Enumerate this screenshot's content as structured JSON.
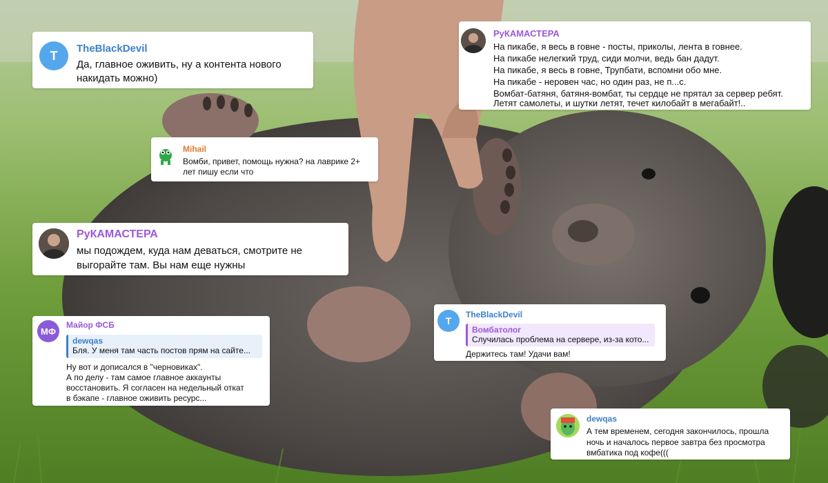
{
  "colors": {
    "blue_name": "#3d7fc9",
    "purple_name": "#9b59d6",
    "orange_name": "#e07a2e",
    "avatar_blue": "#55a7ec",
    "avatar_purple": "#8b5ad8"
  },
  "comments": [
    {
      "author": "TheBlackDevil",
      "avatar_letter": "T",
      "lines": [
        "Да, главное оживить, ну а контента нового",
        "накидать можно)"
      ]
    },
    {
      "author": "РуКАМАСТЕРА",
      "lines": [
        "На пикабе, я весь в говне - посты, приколы, лента в говнее.",
        "На пикабе нелегкий труд, сиди молчи, ведь бан дадут.",
        "На пикабе, я весь в говне, Трупбати, вспомни обо мне.",
        "На пикабе - неровен час, но один раз, не п...с.",
        "Вомбат-батяня, батяня-вомбат, ты сердце не прятал за сервер ребят.",
        "Летят самолеты, и шутки летят, течет килобайт в мегабайт!.."
      ]
    },
    {
      "author": "Mihail",
      "lines": [
        "Вомби, привет, помощь нужна? на лаврике 2+",
        "лет пишу если что"
      ]
    },
    {
      "author": "РуКАМАСТЕРА",
      "lines": [
        "мы подождем, куда нам деваться, смотрите не",
        "выгорайте там. Вы нам еще нужны"
      ]
    },
    {
      "author": "Майор ФСБ",
      "avatar_letter": "МФ",
      "quote_author": "dewqas",
      "quote_text": "Бля. У меня там часть постов прям на сайте...",
      "lines": [
        "Ну вот и дописался в \"черновиках\".",
        "А по делу - там самое главное аккаунты",
        "восстановить. Я согласен на недельный откат",
        "в бэкапе - главное оживить ресурс..."
      ]
    },
    {
      "author": "TheBlackDevil",
      "avatar_letter": "T",
      "quote_author": "Вомбатолог",
      "quote_text": "Случилась проблема на сервере, из-за кото...",
      "lines": [
        "Держитесь там! Удачи вам!"
      ]
    },
    {
      "author": "dewqas",
      "lines": [
        "А тем временем, сегодня закончилось, прошла",
        "ночь и началось первое завтра без просмотра",
        "вмбатика под кофе((("
      ]
    }
  ]
}
